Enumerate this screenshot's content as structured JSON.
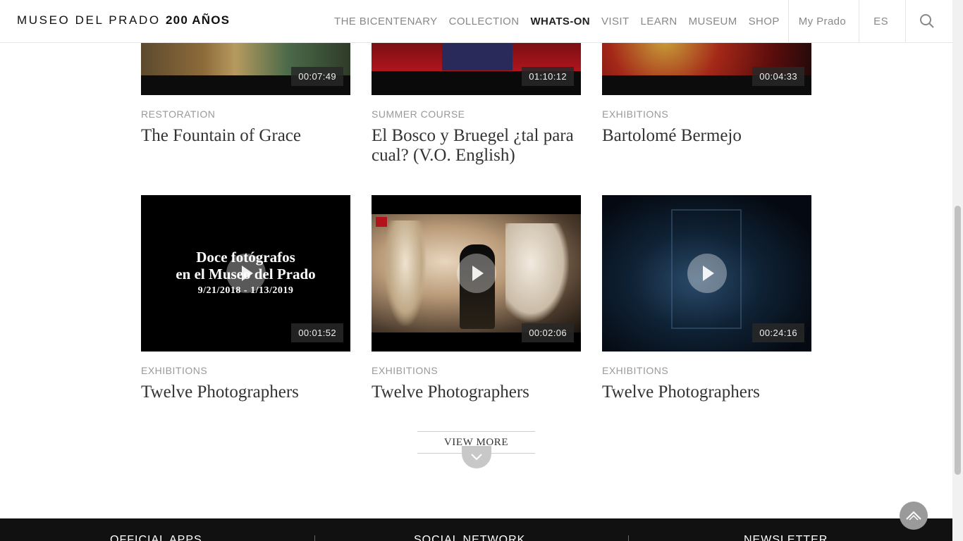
{
  "header": {
    "logo_text": "MUSEO DEL PRADO",
    "logo_bold": "200 AÑOS",
    "nav": [
      "THE BICENTENARY",
      "COLLECTION",
      "WHATS-ON",
      "VISIT",
      "LEARN",
      "MUSEUM",
      "SHOP"
    ],
    "active": "WHATS-ON",
    "my_prado": "My Prado",
    "lang": "ES",
    "search_icon": "search-icon"
  },
  "cards_top": [
    {
      "category": "RESTORATION",
      "title": "The Fountain of Grace",
      "duration": "00:07:49"
    },
    {
      "category": "SUMMER COURSE",
      "title": "El Bosco y Bruegel ¿tal para cual? (V.O. English)",
      "duration": "01:10:12"
    },
    {
      "category": "EXHIBITIONS",
      "title": "Bartolomé Bermejo",
      "duration": "00:04:33"
    }
  ],
  "cards_bottom": [
    {
      "category": "EXHIBITIONS",
      "title": "Twelve Photographers",
      "duration": "00:01:52"
    },
    {
      "category": "EXHIBITIONS",
      "title": "Twelve Photographers",
      "duration": "00:02:06"
    },
    {
      "category": "EXHIBITIONS",
      "title": "Twelve Photographers",
      "duration": "00:24:16"
    }
  ],
  "doce_thumb": {
    "line1": "Doce fotógrafos",
    "line2": "en el Museo del Prado",
    "dates": "9/21/2018 - 1/13/2019"
  },
  "view_more": "VIEW MORE",
  "footer": {
    "apps": "OFFICIAL APPS",
    "social": "SOCIAL NETWORK",
    "newsletter": "NEWSLETTER"
  },
  "colors": {
    "accent_dark": "#111111",
    "muted": "#999999",
    "nav_muted": "#888888"
  }
}
